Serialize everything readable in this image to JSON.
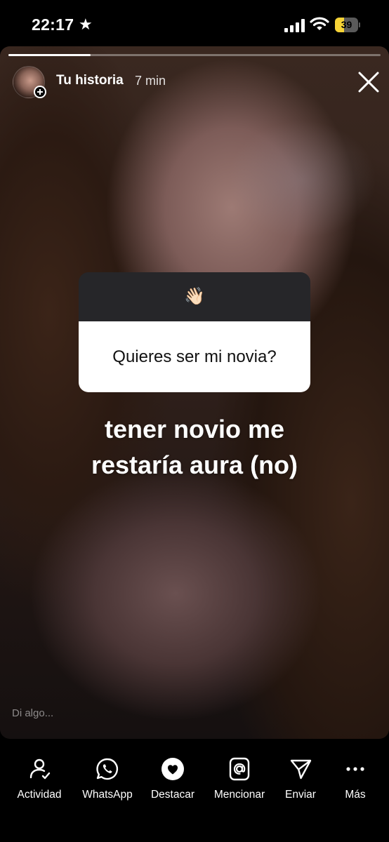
{
  "status_bar": {
    "time": "22:17",
    "star_icon": "★",
    "battery": "39",
    "battery_level": 0.39,
    "icons": [
      "signal-icon",
      "wifi-icon",
      "battery-icon"
    ]
  },
  "story": {
    "owner": "Tu historia",
    "time_ago": "7 min",
    "progress": 0.22,
    "question_emoji": "👋🏻",
    "question": "Quieres ser mi novia?",
    "answer_line1": "tener novio me",
    "answer_line2": "restaría aura (no)",
    "reply_placeholder": "Di algo..."
  },
  "toolbar": {
    "actividad": "Actividad",
    "whatsapp": "WhatsApp",
    "destacar": "Destacar",
    "mencionar": "Mencionar",
    "enviar": "Enviar",
    "mas": "Más"
  },
  "colors": {
    "question_header": "#262629",
    "battery_fill": "#f6d336",
    "background": "#000000"
  }
}
